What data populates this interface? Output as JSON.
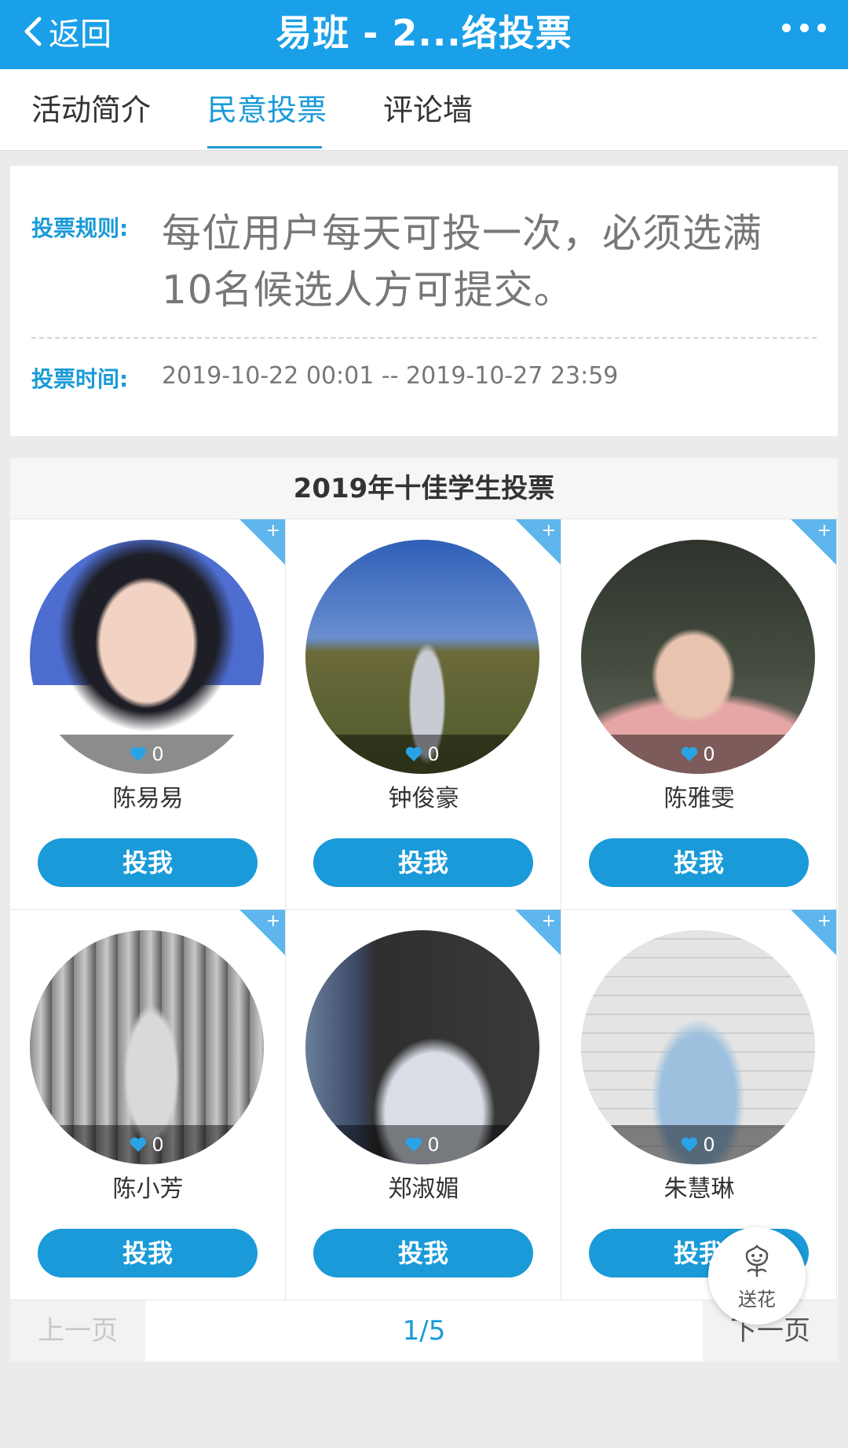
{
  "header": {
    "back_label": "返回",
    "title": "易班 - 2...络投票"
  },
  "tabs": [
    {
      "label": "活动简介"
    },
    {
      "label": "民意投票"
    },
    {
      "label": "评论墙"
    }
  ],
  "rules": {
    "rule_label": "投票规则:",
    "rule_text": "每位用户每天可投一次，必须选满10名候选人方可提交。",
    "time_label": "投票时间:",
    "time_text": "2019-10-22 00:01 -- 2019-10-27 23:59"
  },
  "section": {
    "title": "2019年十佳学生投票"
  },
  "candidates": [
    {
      "name": "陈易易",
      "likes": "0",
      "vote_label": "投我"
    },
    {
      "name": "钟俊豪",
      "likes": "0",
      "vote_label": "投我"
    },
    {
      "name": "陈雅雯",
      "likes": "0",
      "vote_label": "投我"
    },
    {
      "name": "陈小芳",
      "likes": "0",
      "vote_label": "投我"
    },
    {
      "name": "郑淑媚",
      "likes": "0",
      "vote_label": "投我"
    },
    {
      "name": "朱慧琳",
      "likes": "0",
      "vote_label": "投我"
    }
  ],
  "corner_symbol": "+",
  "pager": {
    "prev_label": "上一页",
    "page": "1/5",
    "next_label": "下一页"
  },
  "flower": {
    "label": "送花"
  },
  "colors": {
    "header_bg": "#1aa0e8",
    "accent": "#1a9ad8",
    "page_bg": "#ebebeb"
  }
}
